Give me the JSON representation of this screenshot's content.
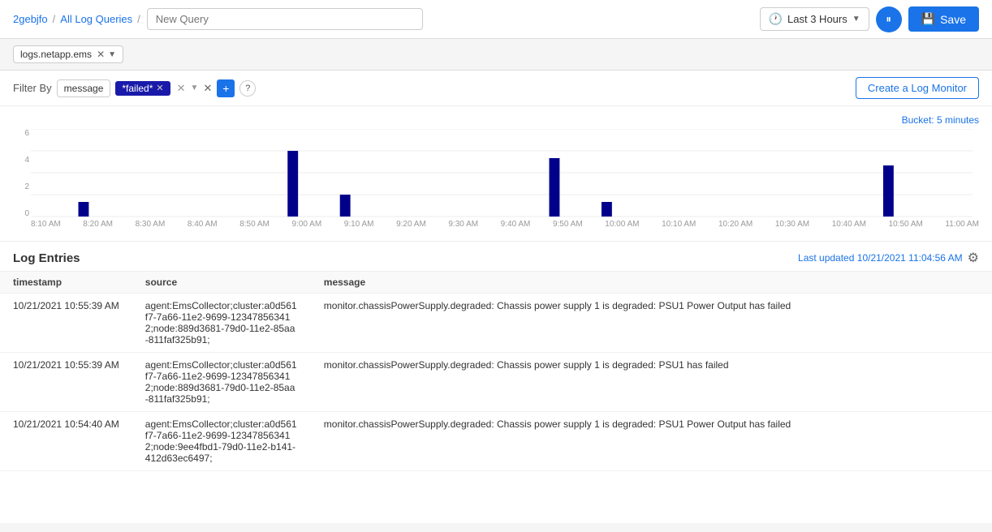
{
  "header": {
    "breadcrumb_org": "2gebjfo",
    "breadcrumb_sep1": "/",
    "breadcrumb_logs": "All Log Queries",
    "breadcrumb_sep2": "/",
    "query_placeholder": "New Query",
    "time_range": "Last 3 Hours",
    "pause_label": "⏸",
    "save_label": "Save"
  },
  "filter": {
    "data_source": "logs.netapp.ems",
    "filter_by_label": "Filter By",
    "field_label": "message",
    "tag_value": "*failed*",
    "help_char": "?"
  },
  "chart": {
    "bucket_label": "Bucket:",
    "bucket_value": "5 minutes",
    "y_labels": [
      "6",
      "4",
      "2",
      "0"
    ],
    "x_labels": [
      "8:10 AM",
      "8:20 AM",
      "8:30 AM",
      "8:40 AM",
      "8:50 AM",
      "9:00 AM",
      "9:10 AM",
      "9:20 AM",
      "9:30 AM",
      "9:40 AM",
      "9:50 AM",
      "10:00 AM",
      "10:10 AM",
      "10:20 AM",
      "10:30 AM",
      "10:40 AM",
      "10:50 AM",
      "11:00 AM"
    ]
  },
  "log_entries": {
    "title": "Log Entries",
    "updated_label": "Last updated",
    "updated_value": "10/21/2021 11:04:56 AM",
    "create_monitor_btn": "Create a Log Monitor",
    "columns": [
      "timestamp",
      "source",
      "message"
    ],
    "rows": [
      {
        "timestamp": "10/21/2021 10:55:39 AM",
        "source": "agent:EmsCollector;cluster:a0d561f7-7a66-11e2-9699-123478563412;node:889d3681-79d0-11e2-85aa-811faf325b91;",
        "message": "monitor.chassisPowerSupply.degraded: Chassis power supply 1 is degraded: PSU1 Power Output has failed"
      },
      {
        "timestamp": "10/21/2021 10:55:39 AM",
        "source": "agent:EmsCollector;cluster:a0d561f7-7a66-11e2-9699-123478563412;node:889d3681-79d0-11e2-85aa-811faf325b91;",
        "message": "monitor.chassisPowerSupply.degraded: Chassis power supply 1 is degraded: PSU1 has failed"
      },
      {
        "timestamp": "10/21/2021 10:54:40 AM",
        "source": "agent:EmsCollector;cluster:a0d561f7-7a66-11e2-9699-123478563412;node:9ee4fbd1-79d0-11e2-b141-412d63ec6497;",
        "message": "monitor.chassisPowerSupply.degraded: Chassis power supply 1 is degraded: PSU1 Power Output has failed"
      }
    ]
  }
}
